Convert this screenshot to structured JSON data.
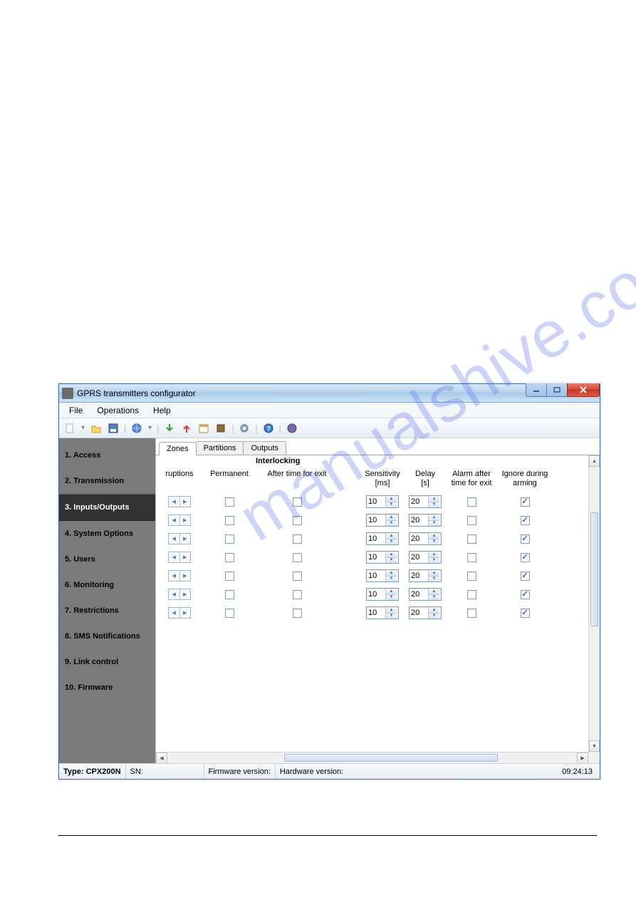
{
  "watermark": "manualshive.com",
  "window": {
    "title": "GPRS transmitters configurator",
    "menu": {
      "file": "File",
      "operations": "Operations",
      "help": "Help"
    }
  },
  "sidebar": {
    "items": [
      {
        "label": "1. Access"
      },
      {
        "label": "2. Transmission"
      },
      {
        "label": "3. Inputs/Outputs",
        "active": true
      },
      {
        "label": "4. System Options"
      },
      {
        "label": "5. Users"
      },
      {
        "label": "6. Monitoring"
      },
      {
        "label": "7. Restrictions"
      },
      {
        "label": "8. SMS Notifications"
      },
      {
        "label": "9. Link control"
      },
      {
        "label": "10. Firmware"
      }
    ]
  },
  "tabs": {
    "zones": "Zones",
    "partitions": "Partitions",
    "outputs": "Outputs",
    "active": "zones"
  },
  "columns": {
    "group": "Interlocking",
    "ruptions": "ruptions",
    "permanent": "Permanent",
    "after_exit": "After time for exit",
    "sensitivity": "Sensitivity\n[ms]",
    "delay": "Delay\n[s]",
    "alarm_after": "Alarm after\ntime for exit",
    "ignore": "Ignore during\narming"
  },
  "rows": [
    {
      "permanent": false,
      "after_exit": false,
      "sensitivity": 10,
      "delay": 20,
      "alarm_after": false,
      "ignore": true
    },
    {
      "permanent": false,
      "after_exit": false,
      "sensitivity": 10,
      "delay": 20,
      "alarm_after": false,
      "ignore": true
    },
    {
      "permanent": false,
      "after_exit": false,
      "sensitivity": 10,
      "delay": 20,
      "alarm_after": false,
      "ignore": true
    },
    {
      "permanent": false,
      "after_exit": false,
      "sensitivity": 10,
      "delay": 20,
      "alarm_after": false,
      "ignore": true
    },
    {
      "permanent": false,
      "after_exit": false,
      "sensitivity": 10,
      "delay": 20,
      "alarm_after": false,
      "ignore": true
    },
    {
      "permanent": false,
      "after_exit": false,
      "sensitivity": 10,
      "delay": 20,
      "alarm_after": false,
      "ignore": true
    },
    {
      "permanent": false,
      "after_exit": false,
      "sensitivity": 10,
      "delay": 20,
      "alarm_after": false,
      "ignore": true
    }
  ],
  "status": {
    "type_label": "Type:",
    "type_value": "CPX200N",
    "sn_label": "SN:",
    "fw_label": "Firmware version:",
    "hw_label": "Hardware version:",
    "clock": "09:24:13"
  }
}
